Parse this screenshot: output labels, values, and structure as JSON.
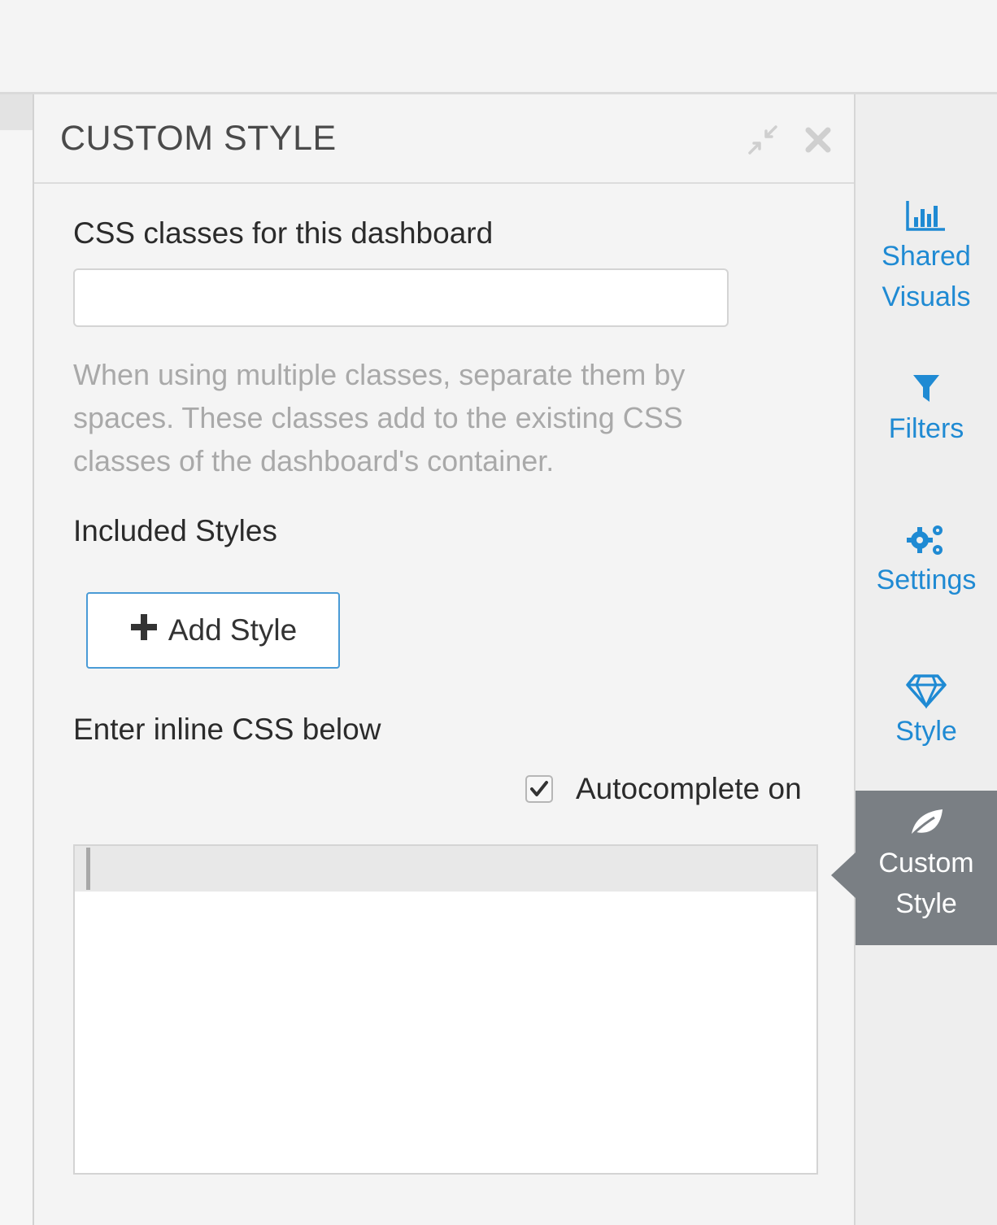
{
  "panel": {
    "title": "CUSTOM STYLE",
    "css_classes_label": "CSS classes for this dashboard",
    "css_classes_value": "",
    "help_text": "When using multiple classes, separate them by spaces. These classes add to the existing CSS classes of the dashboard's container.",
    "included_styles_label": "Included Styles",
    "add_style_label": "Add Style",
    "inline_css_label": "Enter inline CSS below",
    "autocomplete_label": "Autocomplete on",
    "autocomplete_checked": true,
    "inline_css_value": ""
  },
  "sidebar": {
    "items": [
      {
        "line1": "Shared",
        "line2": "Visuals",
        "icon": "bar-chart-icon"
      },
      {
        "line1": "Filters",
        "line2": "",
        "icon": "filter-icon"
      },
      {
        "line1": "Settings",
        "line2": "",
        "icon": "gears-icon"
      },
      {
        "line1": "Style",
        "line2": "",
        "icon": "diamond-icon"
      },
      {
        "line1": "Custom",
        "line2": "Style",
        "icon": "leaf-icon",
        "active": true
      }
    ]
  },
  "colors": {
    "accent": "#1f8ad3",
    "active_tab": "#7a7f84",
    "button_border": "#4a9bd6"
  }
}
